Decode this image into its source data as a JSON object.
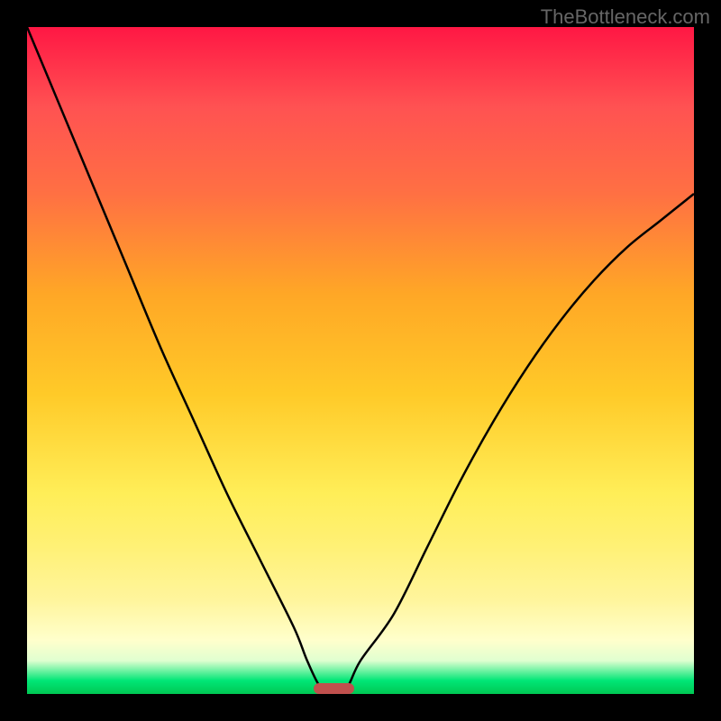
{
  "watermark": "TheBottleneck.com",
  "chart_data": {
    "type": "line",
    "title": "",
    "xlabel": "",
    "ylabel": "",
    "x": [
      0,
      5,
      10,
      15,
      20,
      25,
      30,
      35,
      40,
      42,
      44,
      46,
      48,
      50,
      55,
      60,
      65,
      70,
      75,
      80,
      85,
      90,
      95,
      100
    ],
    "values": [
      100,
      88,
      76,
      64,
      52,
      41,
      30,
      20,
      10,
      5,
      1,
      0,
      1,
      5,
      12,
      22,
      32,
      41,
      49,
      56,
      62,
      67,
      71,
      75
    ],
    "ylim": [
      0,
      100
    ],
    "xlim": [
      0,
      100
    ],
    "optimal_range": [
      43,
      49
    ],
    "gradient_stops": [
      {
        "pos": 0,
        "color": "#ff1744"
      },
      {
        "pos": 25,
        "color": "#ff7043"
      },
      {
        "pos": 55,
        "color": "#ffca28"
      },
      {
        "pos": 78,
        "color": "#fff176"
      },
      {
        "pos": 95,
        "color": "#e0ffd0"
      },
      {
        "pos": 100,
        "color": "#00c853"
      }
    ]
  }
}
